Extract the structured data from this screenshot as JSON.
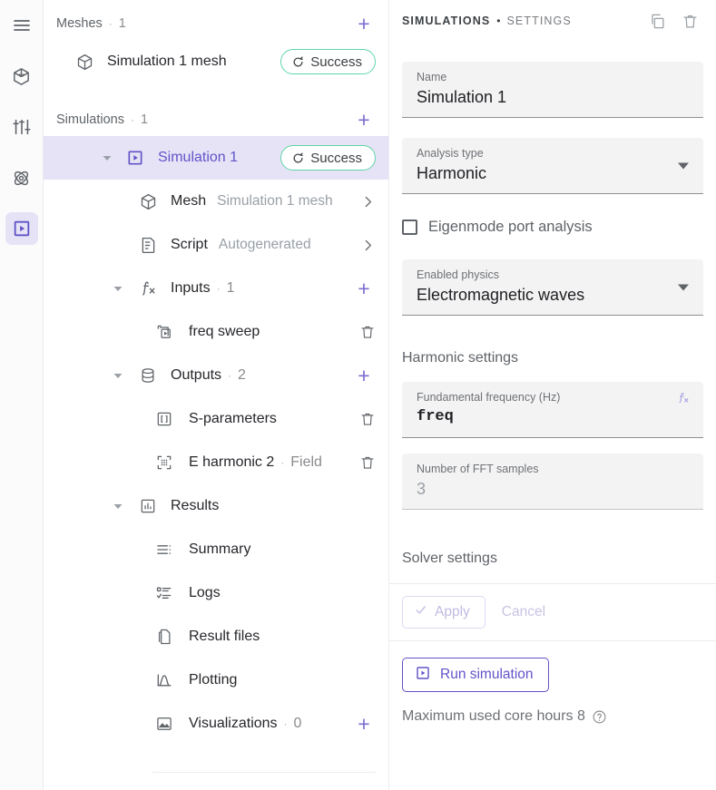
{
  "rail": {
    "items": [
      {
        "icon": "hamburger-menu-icon",
        "name": "menu-button",
        "active": false
      },
      {
        "icon": "geometry-cube-icon",
        "name": "geometry-button",
        "active": false
      },
      {
        "icon": "sliders-icon",
        "name": "materials-button",
        "active": false
      },
      {
        "icon": "atom-physics-icon",
        "name": "physics-button",
        "active": false
      },
      {
        "icon": "play-square-icon",
        "name": "simulations-button",
        "active": true
      }
    ]
  },
  "tree": {
    "meshes_section": {
      "title": "Meshes",
      "separator": "·",
      "count": "1",
      "add_label": "+"
    },
    "mesh_item": {
      "label": "Simulation 1 mesh",
      "status": "Success"
    },
    "simulations_section": {
      "title": "Simulations",
      "separator": "·",
      "count": "1",
      "add_label": "+"
    },
    "simulation_item": {
      "label": "Simulation 1",
      "status": "Success"
    },
    "nodes": {
      "mesh": {
        "label": "Mesh",
        "value": "Simulation 1 mesh"
      },
      "script": {
        "label": "Script",
        "value": "Autogenerated"
      },
      "inputs": {
        "label": "Inputs",
        "separator": "·",
        "count": "1",
        "add_label": "+"
      },
      "freq_sweep": {
        "label": "freq sweep"
      },
      "outputs": {
        "label": "Outputs",
        "separator": "·",
        "count": "2",
        "add_label": "+"
      },
      "s_parameters": {
        "label": "S-parameters"
      },
      "e_harmonic": {
        "label": "E harmonic 2",
        "separator": "·",
        "value": "Field"
      },
      "results": {
        "label": "Results"
      },
      "summary": {
        "label": "Summary"
      },
      "logs": {
        "label": "Logs"
      },
      "result_files": {
        "label": "Result files"
      },
      "plotting": {
        "label": "Plotting"
      },
      "visualizations": {
        "label": "Visualizations",
        "separator": "·",
        "count": "0",
        "add_label": "+"
      }
    }
  },
  "settings": {
    "breadcrumb_primary": "SIMULATIONS",
    "breadcrumb_separator": "•",
    "breadcrumb_secondary": "SETTINGS",
    "duplicate_icon": "copy-icon",
    "delete_icon": "trash-icon",
    "name_field": {
      "label": "Name",
      "value": "Simulation 1"
    },
    "analysis_type_field": {
      "label": "Analysis type",
      "value": "Harmonic"
    },
    "eigenmode_checkbox": {
      "label": "Eigenmode port analysis",
      "checked": false
    },
    "enabled_physics_field": {
      "label": "Enabled physics",
      "value": "Electromagnetic waves"
    },
    "harmonic_settings_title": "Harmonic settings",
    "fundamental_frequency_field": {
      "label": "Fundamental frequency (Hz)",
      "value": "freq",
      "fx_icon": "function-icon"
    },
    "fft_samples_field": {
      "label": "Number of FFT samples",
      "value": "3"
    },
    "solver_settings_title": "Solver settings",
    "apply_button": "Apply",
    "cancel_button": "Cancel",
    "run_button": "Run simulation",
    "core_hours_text": "Maximum used core hours 8",
    "help_icon": "help-circle-icon"
  },
  "colors": {
    "accent_purple": "#6154c8",
    "accent_purple_light": "#7b6fd0",
    "selection_bg": "#e6e3f6",
    "success_border": "#5fd6a8",
    "panel_border": "#ececed",
    "field_bg": "#f3f3f4",
    "muted_text": "#9aa0a6"
  }
}
